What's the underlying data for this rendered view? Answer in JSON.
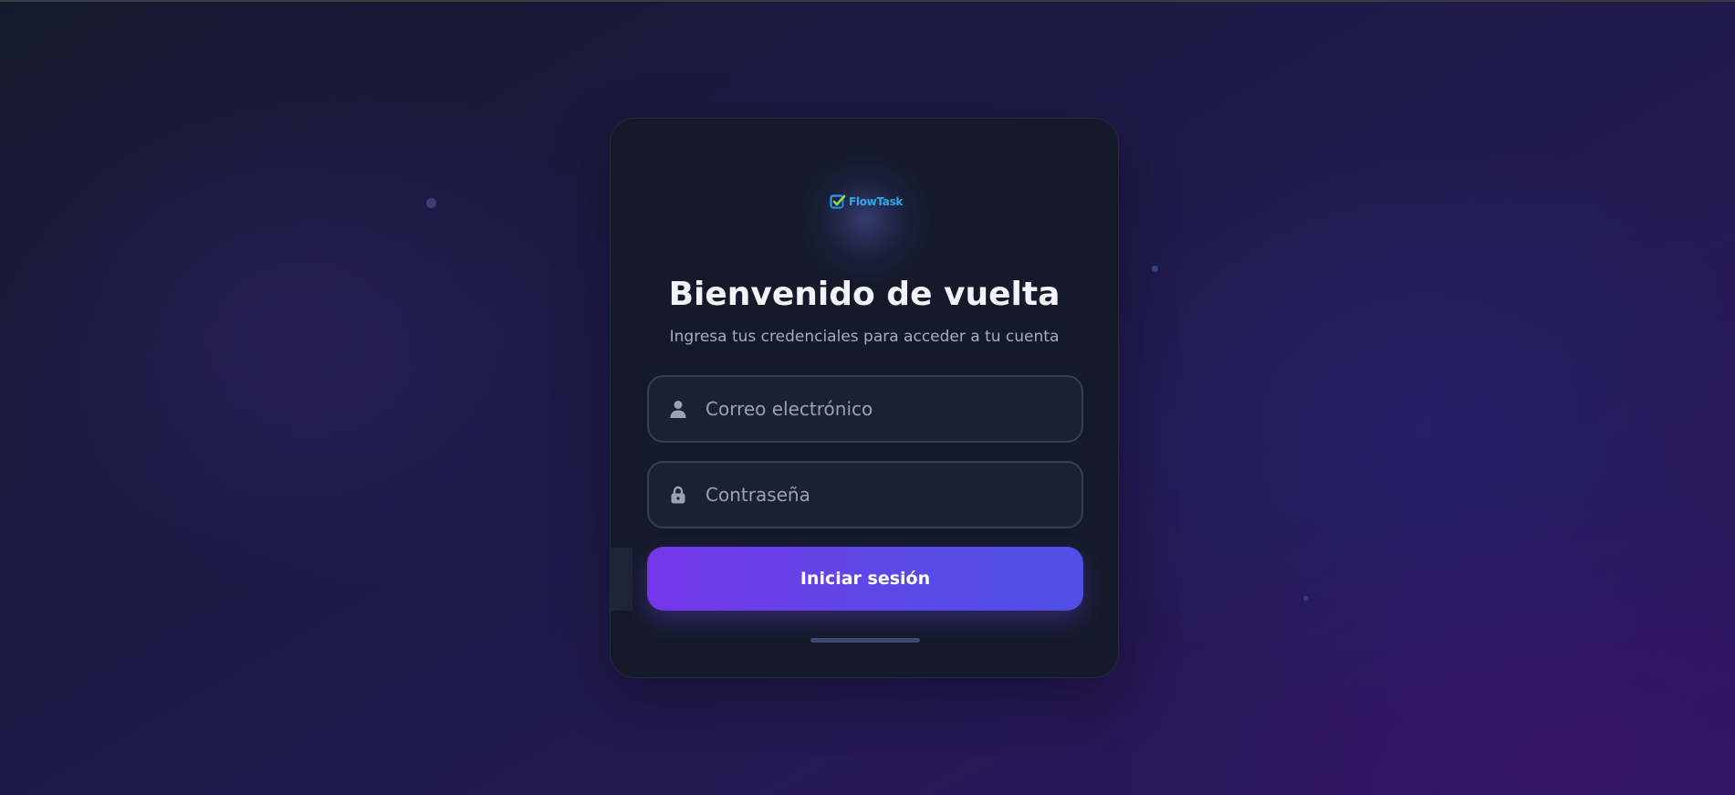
{
  "app": {
    "brand": "FlowTask"
  },
  "login": {
    "title": "Bienvenido de vuelta",
    "subtitle": "Ingresa tus credenciales para acceder a tu cuenta",
    "email_placeholder": "Correo electrónico",
    "password_placeholder": "Contraseña",
    "submit_label": "Iniciar sesión"
  },
  "icons": {
    "email": "user-icon",
    "password": "lock-icon",
    "logo": "check-square-icon"
  },
  "colors": {
    "accent_start": "#7536e9",
    "accent_end": "#4f4fe6",
    "card_bg": "#141a2a",
    "brand_text": "#2ea8f0"
  }
}
